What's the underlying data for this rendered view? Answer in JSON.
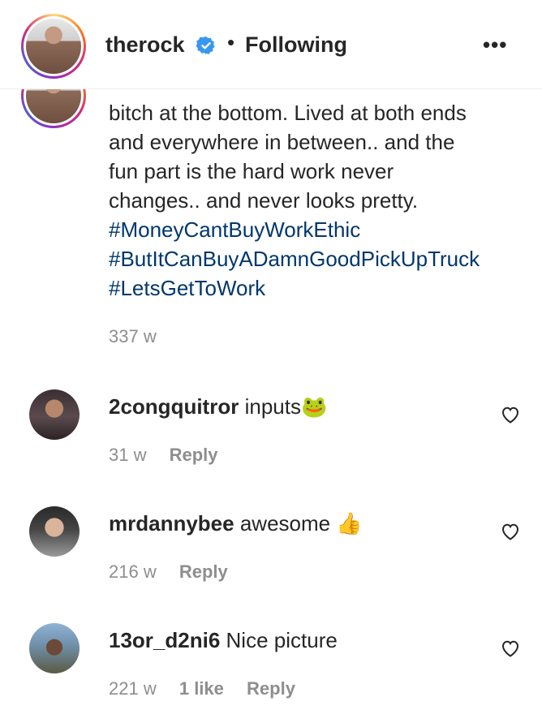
{
  "header": {
    "username": "therock",
    "separator": "•",
    "follow_status": "Following",
    "more_label": "•••"
  },
  "caption": {
    "lines": [
      "bitch at the bottom. Lived at both ends",
      "and everywhere in between.. and the",
      "fun part is the hard work never",
      "changes.. and never looks pretty."
    ],
    "hashtags": [
      "#MoneyCantBuyWorkEthic",
      "#ButItCanBuyADamnGoodPickUpTruck",
      "#LetsGetToWork"
    ],
    "time": "337 w"
  },
  "comments": [
    {
      "username": "2congquitror",
      "text": "inputs🐸",
      "time": "31 w",
      "likes": "",
      "reply": "Reply"
    },
    {
      "username": "mrdannybee",
      "text": "awesome 👍",
      "time": "216 w",
      "likes": "",
      "reply": "Reply"
    },
    {
      "username": "13or_d2ni6",
      "text": "Nice picture",
      "time": "221 w",
      "likes": "1 like",
      "reply": "Reply"
    }
  ],
  "colors": {
    "hashtag": "#00376b",
    "muted": "#8e8e8e",
    "verified": "#3897f0"
  }
}
